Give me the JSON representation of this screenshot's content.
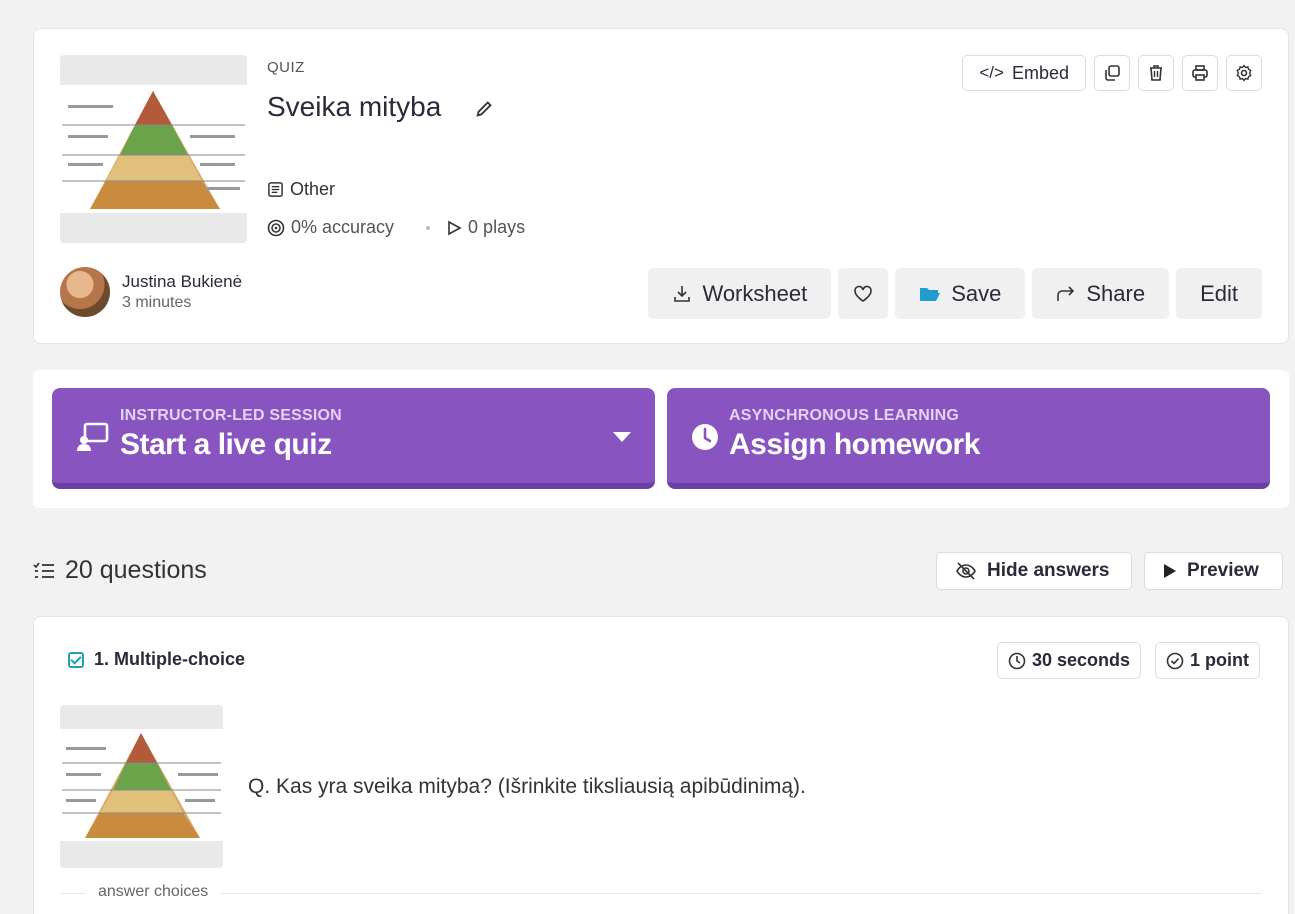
{
  "quiz": {
    "type_label": "QUIZ",
    "title": "Sveika mityba",
    "subject": "Other",
    "accuracy": "0% accuracy",
    "plays": "0 plays"
  },
  "toolbar": {
    "embed_label": "Embed"
  },
  "author": {
    "name": "Justina Bukienė",
    "time": "3 minutes"
  },
  "actions": {
    "worksheet": "Worksheet",
    "save": "Save",
    "share": "Share",
    "edit": "Edit"
  },
  "session": {
    "live": {
      "kicker": "INSTRUCTOR-LED SESSION",
      "label": "Start a live quiz"
    },
    "homework": {
      "kicker": "ASYNCHRONOUS LEARNING",
      "label": "Assign homework"
    }
  },
  "questions": {
    "count_label": "20 questions",
    "hide_answers": "Hide answers",
    "preview": "Preview"
  },
  "question1": {
    "label": "1. Multiple-choice",
    "time": "30 seconds",
    "points": "1 point",
    "text": "Q. Kas yra sveika mityba? (Išrinkite tiksliausią apibūdinimą).",
    "answer_choices_label": "answer choices"
  },
  "colors": {
    "accent_purple": "#8854c0",
    "save_blue": "#1e9ccd",
    "check_teal": "#20a0a8"
  }
}
